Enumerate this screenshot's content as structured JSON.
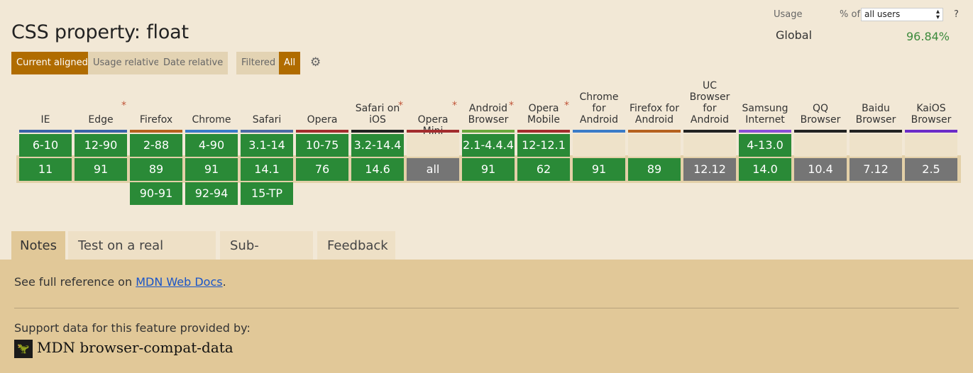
{
  "title": "CSS property: float",
  "usage": {
    "label": "Usage",
    "pct_of": "% of",
    "selected": "all users",
    "help": "?",
    "region": "Global",
    "value": "96.84%"
  },
  "toolbar": {
    "current_aligned": "Current aligned",
    "usage_relative": "Usage relative",
    "date_relative": "Date relative",
    "filtered": "Filtered",
    "all": "All"
  },
  "colors": {
    "supported": "#2a8a37",
    "unsupported": "#757575",
    "empty": "#eee2c9",
    "accent": "#b06c00"
  },
  "browsers": [
    {
      "name": "IE",
      "line": "#3a63a8",
      "star": false,
      "past": "6-10",
      "current": "11",
      "future": [
        "",
        ""
      ],
      "state": "y"
    },
    {
      "name": "Edge",
      "line": "#3a63a8",
      "star": true,
      "past": "12-90",
      "current": "91",
      "future": [
        "",
        ""
      ],
      "state": "y"
    },
    {
      "name": "Firefox",
      "line": "#b5611e",
      "star": false,
      "past": "2-88",
      "current": "89",
      "future": [
        "90-91",
        ""
      ],
      "state": "y"
    },
    {
      "name": "Chrome",
      "line": "#3a7bc8",
      "star": false,
      "past": "4-90",
      "current": "91",
      "future": [
        "92-94",
        ""
      ],
      "state": "y"
    },
    {
      "name": "Safari",
      "line": "#4b6ba5",
      "star": false,
      "past": "3.1-14",
      "current": "14.1",
      "future": [
        "15-TP",
        ""
      ],
      "state": "y"
    },
    {
      "name": "Opera",
      "line": "#a32d2d",
      "star": false,
      "past": "10-75",
      "current": "76",
      "future": [
        "",
        ""
      ],
      "state": "y"
    },
    {
      "name": "Safari on iOS",
      "line": "#222222",
      "star": true,
      "past": "3.2-14.4",
      "current": "14.6",
      "future": [
        "",
        ""
      ],
      "state": "y"
    },
    {
      "name": "Opera Mini",
      "line": "#a32d2d",
      "star": true,
      "past": "",
      "current": "all",
      "future": [
        "",
        ""
      ],
      "state": "n"
    },
    {
      "name": "Android Browser",
      "line": "#6aa73c",
      "star": true,
      "past": "2.1-4.4.4",
      "current": "91",
      "future": [
        "",
        ""
      ],
      "state": "y"
    },
    {
      "name": "Opera Mobile",
      "line": "#a32d2d",
      "star": true,
      "past": "12-12.1",
      "current": "62",
      "future": [
        "",
        ""
      ],
      "state": "y"
    },
    {
      "name": "Chrome for Android",
      "line": "#3a7bc8",
      "star": false,
      "past": "",
      "current": "91",
      "future": [
        "",
        ""
      ],
      "state": "y"
    },
    {
      "name": "Firefox for Android",
      "line": "#b5611e",
      "star": false,
      "past": "",
      "current": "89",
      "future": [
        "",
        ""
      ],
      "state": "y"
    },
    {
      "name": "UC Browser for Android",
      "line": "#222222",
      "star": false,
      "past": "",
      "current": "12.12",
      "future": [
        "",
        ""
      ],
      "state": "n"
    },
    {
      "name": "Samsung Internet",
      "line": "#8a4fd8",
      "star": false,
      "past": "4-13.0",
      "current": "14.0",
      "future": [
        "",
        ""
      ],
      "state": "y"
    },
    {
      "name": "QQ Browser",
      "line": "#222222",
      "star": false,
      "past": "",
      "current": "10.4",
      "future": [
        "",
        ""
      ],
      "state": "n"
    },
    {
      "name": "Baidu Browser",
      "line": "#222222",
      "star": false,
      "past": "",
      "current": "7.12",
      "future": [
        "",
        ""
      ],
      "state": "n"
    },
    {
      "name": "KaiOS Browser",
      "line": "#6b2cc8",
      "star": false,
      "past": "",
      "current": "2.5",
      "future": [
        "",
        ""
      ],
      "state": "n"
    }
  ],
  "tabs": {
    "notes": "Notes",
    "test": "Test on a real browser",
    "sub": "Sub-features",
    "feedback": "Feedback"
  },
  "notes": {
    "ref_prefix": "See full reference on ",
    "ref_link": "MDN Web Docs",
    "ref_suffix": ".",
    "support_by": "Support data for this feature provided by:",
    "mdn_logo_icon": "mdn-icon",
    "mdn_name": "MDN browser-compat-data"
  }
}
